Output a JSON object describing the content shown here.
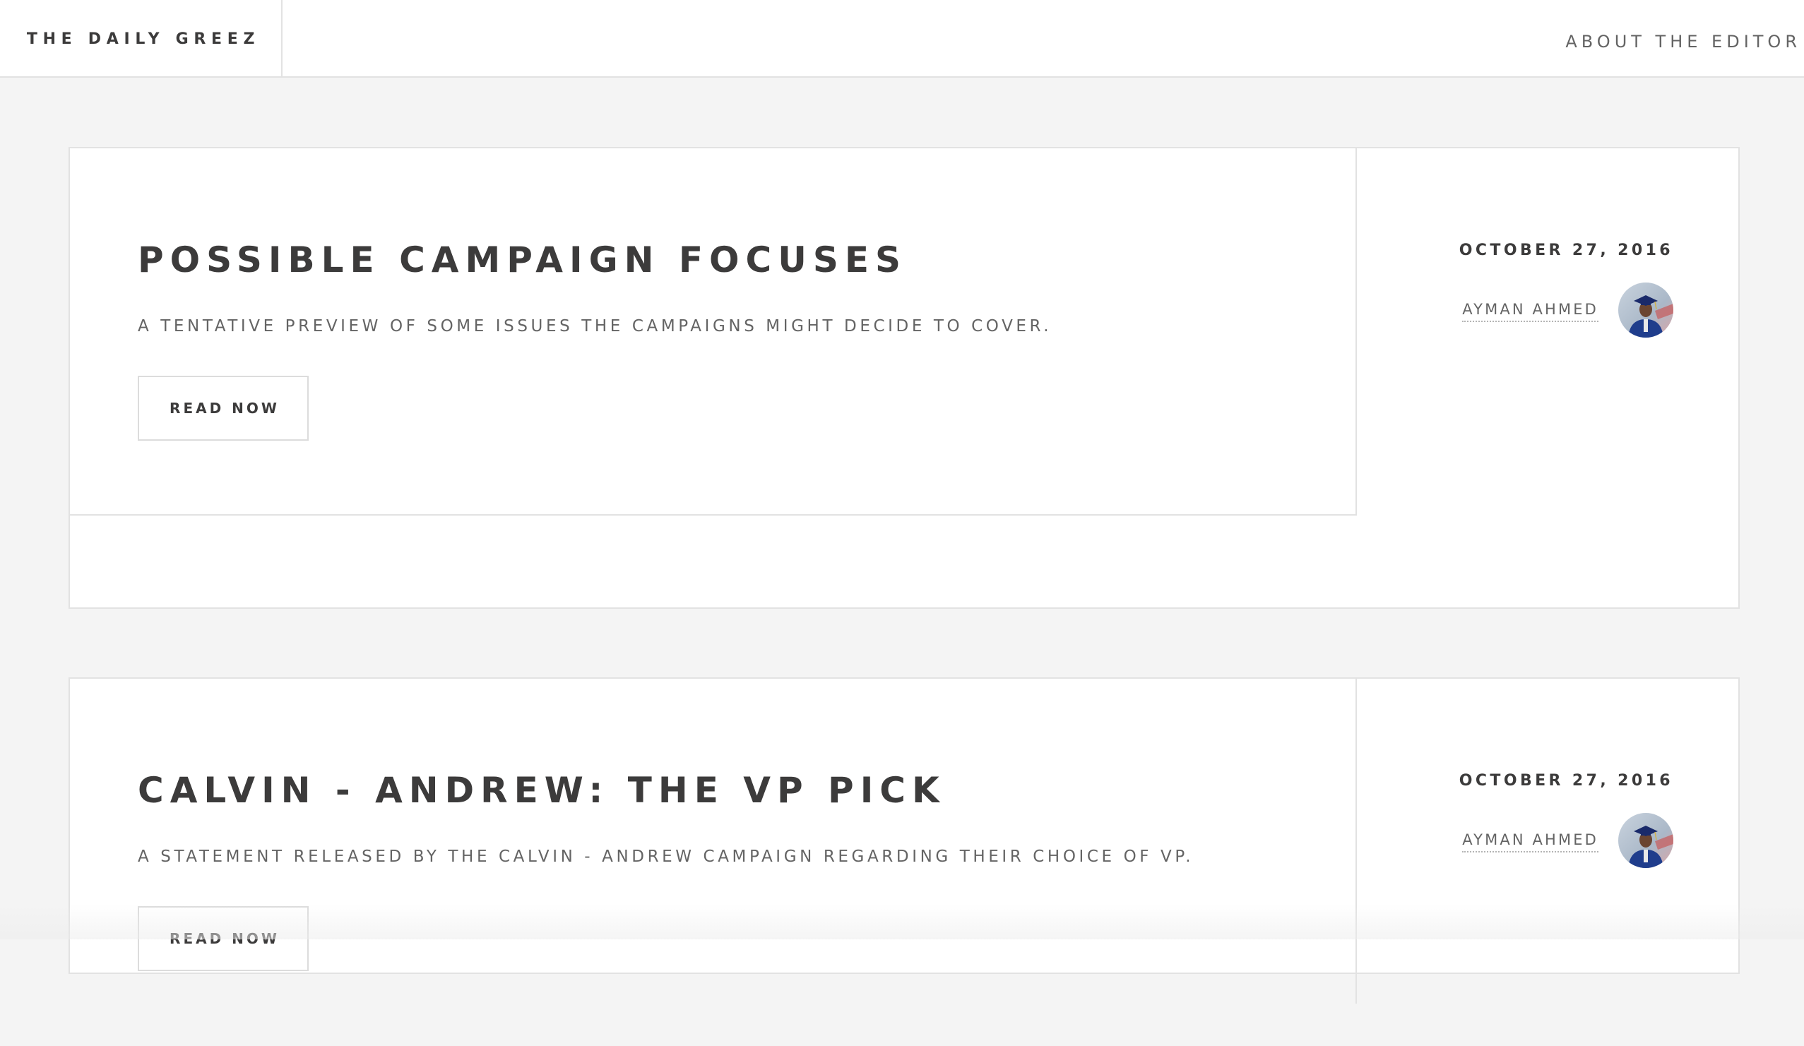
{
  "header": {
    "brand": "THE DAILY GREEZ",
    "nav_link": "ABOUT THE EDITOR"
  },
  "posts": [
    {
      "title": "POSSIBLE CAMPAIGN FOCUSES",
      "subtitle": "A TENTATIVE PREVIEW OF SOME ISSUES THE CAMPAIGNS MIGHT DECIDE TO COVER.",
      "button_label": "READ NOW",
      "date": "OCTOBER 27, 2016",
      "author": "AYMAN AHMED"
    },
    {
      "title": "CALVIN - ANDREW: THE VP PICK",
      "subtitle": "A STATEMENT RELEASED BY THE CALVIN - ANDREW CAMPAIGN REGARDING THEIR CHOICE OF VP.",
      "button_label": "READ NOW",
      "date": "OCTOBER 27, 2016",
      "author": "AYMAN AHMED"
    }
  ],
  "colors": {
    "page_background": "#f4f4f4",
    "card_background": "#ffffff",
    "border": "#e2e2e2",
    "text_dark": "#3c3b3b",
    "text_muted": "#646464"
  },
  "icons": {
    "author_avatar": "author-photo-graduate-avatar"
  }
}
